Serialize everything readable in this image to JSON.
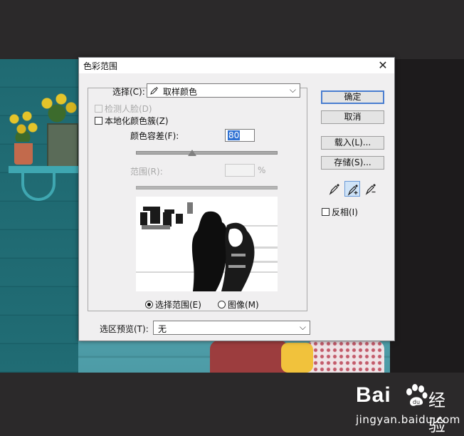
{
  "dialog": {
    "title": "色彩范围",
    "close_glyph": "✕",
    "select_label": "选择(C):",
    "select_value": "取样颜色",
    "detect_faces_label": "检测人脸(D)",
    "localized_label": "本地化颜色簇(Z)",
    "fuzziness_label": "颜色容差(F):",
    "fuzziness_value": "80",
    "range_label": "范围(R):",
    "range_unit": "%",
    "radio_selection_label": "选择范围(E)",
    "radio_image_label": "图像(M)",
    "preview_label": "选区预览(T):",
    "preview_value": "无",
    "buttons": {
      "ok": "确定",
      "cancel": "取消",
      "load": "载入(L)...",
      "save": "存储(S)..."
    },
    "invert_label": "反相(I)",
    "fuzziness_slider_fraction": 0.4,
    "state": {
      "detect_faces_checked": false,
      "detect_faces_enabled": false,
      "localized_checked": false,
      "invert_checked": false,
      "active_eyedropper": "add-to-sample",
      "display_mode": "selection"
    }
  },
  "watermark": {
    "brand": "Bai",
    "suffix": "经验",
    "domain": "jingyan.baidu.com"
  },
  "icons": {
    "select_dropdown_icon": "eyedropper-icon",
    "eyedroppers": [
      "eyedropper-icon",
      "eyedropper-plus-icon",
      "eyedropper-minus-icon"
    ]
  }
}
